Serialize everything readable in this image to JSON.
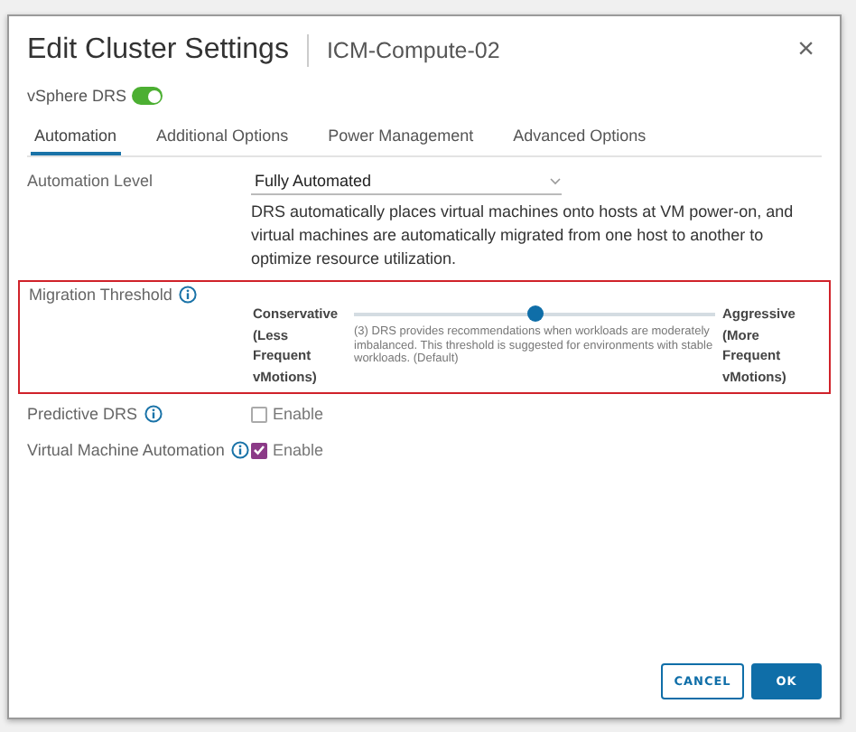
{
  "dialog": {
    "title": "Edit Cluster Settings",
    "subtitle": "ICM-Compute-02",
    "close": "×"
  },
  "drs": {
    "label": "vSphere DRS",
    "on": true
  },
  "tabs": [
    {
      "label": "Automation",
      "selected": true
    },
    {
      "label": "Additional Options",
      "selected": false
    },
    {
      "label": "Power Management",
      "selected": false
    },
    {
      "label": "Advanced Options",
      "selected": false
    }
  ],
  "automation_level": {
    "label": "Automation Level",
    "value": "Fully Automated",
    "description": "DRS automatically places virtual machines onto hosts at VM power-on, and virtual machines are automatically migrated from one host to another to optimize resource utilization."
  },
  "migration_threshold": {
    "label": "Migration Threshold",
    "highlighted": true,
    "min_label": "Conservative (Less Frequent vMotions)",
    "max_label": "Aggressive (More Frequent vMotions)",
    "level": 0.5,
    "description": "(3) DRS provides recommendations when workloads are moderately imbalanced. This threshold is suggested for environments with stable workloads. (Default)"
  },
  "options": [
    {
      "label": "Predictive DRS",
      "checkbox": "Enable",
      "checked": false
    },
    {
      "label": "Virtual Machine Automation",
      "checkbox": "Enable",
      "checked": true
    }
  ],
  "buttons": [
    {
      "label": "CANCEL",
      "primary": false
    },
    {
      "label": "OK",
      "primary": true
    }
  ]
}
